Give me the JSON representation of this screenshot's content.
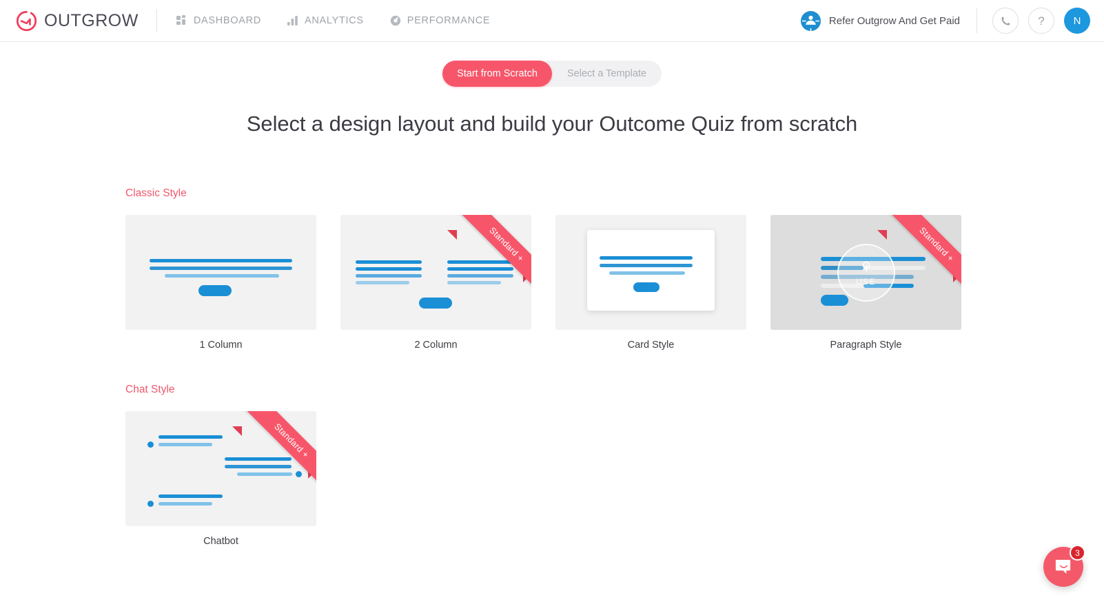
{
  "header": {
    "brand_name": "OUTGROW",
    "brand_icon": "outgrow-logo-icon",
    "nav": [
      {
        "label": "DASHBOARD",
        "icon": "grid-icon"
      },
      {
        "label": "ANALYTICS",
        "icon": "bar-chart-icon"
      },
      {
        "label": "PERFORMANCE",
        "icon": "gauge-icon"
      }
    ],
    "refer": {
      "label": "Refer Outgrow And Get Paid",
      "icon": "referral-person-icon"
    },
    "call_button_icon": "phone-icon",
    "help_button_label": "?",
    "avatar_initial": "N",
    "avatar_color": "#1d97de"
  },
  "toggle": {
    "active": "Start from Scratch",
    "inactive": "Select a Template",
    "active_color": "#f7566a"
  },
  "page_title": "Select a design layout and build your Outcome Quiz from scratch",
  "ribbon_label": "Standard +",
  "use_overlay": {
    "label": "USE",
    "icon": "cursor-click-icon"
  },
  "sections": [
    {
      "title": "Classic Style",
      "title_color": "#f0576c",
      "cards": [
        {
          "caption": "1 Column",
          "layout": "one-column",
          "ribbon": false,
          "hovered": false
        },
        {
          "caption": "2 Column",
          "layout": "two-column",
          "ribbon": true,
          "hovered": false
        },
        {
          "caption": "Card Style",
          "layout": "card-style",
          "ribbon": false,
          "hovered": false
        },
        {
          "caption": "Paragraph Style",
          "layout": "paragraph",
          "ribbon": true,
          "hovered": true
        }
      ]
    },
    {
      "title": "Chat Style",
      "title_color": "#f0576c",
      "cards": [
        {
          "caption": "Chatbot",
          "layout": "chatbot",
          "ribbon": true,
          "hovered": false
        }
      ]
    }
  ],
  "chat_widget": {
    "badge_count": "3",
    "icon": "chat-bubble-icon",
    "color": "#f4596a"
  }
}
